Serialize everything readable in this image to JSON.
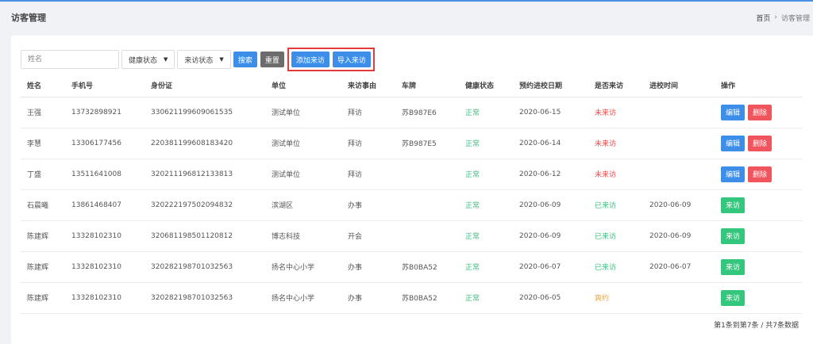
{
  "header": {
    "title": "访客管理",
    "breadcrumb": {
      "home": "首页",
      "separator": "›",
      "current": "访客管理"
    }
  },
  "toolbar": {
    "search_placeholder": "姓名",
    "health_select": "健康状态",
    "visit_select": "来访状态",
    "search_label": "搜索",
    "reset_label": "重置",
    "add_label": "添加来访",
    "import_label": "导入来访"
  },
  "table": {
    "columns": [
      "姓名",
      "手机号",
      "身份证",
      "单位",
      "来访事由",
      "车牌",
      "健康状态",
      "预约进校日期",
      "是否来访",
      "进校时间",
      "操作"
    ],
    "rows": [
      {
        "name": "王强",
        "phone": "13732898921",
        "id_card": "330621199609061535",
        "unit": "测试单位",
        "reason": "拜访",
        "plate": "苏B987E6",
        "health": "正常",
        "date": "2020-06-15",
        "status": "未来访",
        "entry_time": "",
        "actions": [
          "编辑",
          "删除"
        ]
      },
      {
        "name": "李慧",
        "phone": "13306177456",
        "id_card": "220381199608183420",
        "unit": "测试单位",
        "reason": "拜访",
        "plate": "苏B987E5",
        "health": "正常",
        "date": "2020-06-14",
        "status": "未来访",
        "entry_time": "",
        "actions": [
          "编辑",
          "删除"
        ]
      },
      {
        "name": "丁盛",
        "phone": "13511641008",
        "id_card": "320211196812133813",
        "unit": "测试单位",
        "reason": "拜访",
        "plate": "",
        "health": "正常",
        "date": "2020-06-12",
        "status": "未来访",
        "entry_time": "",
        "actions": [
          "编辑",
          "删除"
        ]
      },
      {
        "name": "石晨曦",
        "phone": "13861468407",
        "id_card": "320222197502094832",
        "unit": "滨湖区",
        "reason": "办事",
        "plate": "",
        "health": "正常",
        "date": "2020-06-09",
        "status": "已来访",
        "entry_time": "2020-06-09",
        "actions": [
          "来访"
        ]
      },
      {
        "name": "陈建辉",
        "phone": "13328102310",
        "id_card": "320681198501120812",
        "unit": "博志科技",
        "reason": "开会",
        "plate": "",
        "health": "正常",
        "date": "2020-06-09",
        "status": "已来访",
        "entry_time": "2020-06-09",
        "actions": [
          "来访"
        ]
      },
      {
        "name": "陈建辉",
        "phone": "13328102310",
        "id_card": "320282198701032563",
        "unit": "扬名中心小学",
        "reason": "办事",
        "plate": "苏B0BA52",
        "health": "正常",
        "date": "2020-06-07",
        "status": "已来访",
        "entry_time": "2020-06-07",
        "actions": [
          "来访"
        ]
      },
      {
        "name": "陈建辉",
        "phone": "13328102310",
        "id_card": "320282198701032563",
        "unit": "扬名中心小学",
        "reason": "办事",
        "plate": "苏B0BA52",
        "health": "正常",
        "date": "2020-06-05",
        "status": "爽约",
        "entry_time": "",
        "actions": [
          "来访"
        ]
      }
    ]
  },
  "footer": {
    "summary": "第1条到第7条 / 共7条数据"
  },
  "colors": {
    "accent": "#3c8ee8",
    "danger": "#f0555e",
    "success": "#32c77c",
    "highlight": "#e23b3b"
  }
}
